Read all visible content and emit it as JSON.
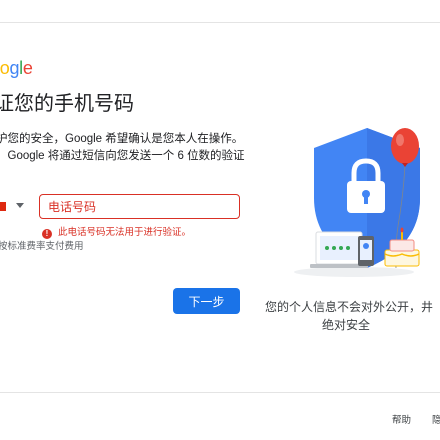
{
  "logo": {
    "text": "oogle",
    "colors": [
      "#4285f4",
      "#ea4335",
      "#fbbc05",
      "#4285f4",
      "#34a853",
      "#ea4335"
    ]
  },
  "page_title": "证您的手机号码",
  "description": {
    "line1": "护您的安全，Google 希望确认是您本人在操作。",
    "line2": "，Google 将通过短信向您发送一个 6 位数的验证"
  },
  "country_select": {
    "flag": "china-flag-icon",
    "selected": ""
  },
  "phone_field": {
    "placeholder": "电话号码",
    "value": ""
  },
  "error_message": "此电话号码无法用于进行验证。",
  "error_icon": "!",
  "fee_note": "按标准费率支付费用",
  "next_button": "下一步",
  "privacy": {
    "line1": "您的个人信息不会对外公开，井",
    "line2": "绝对安全"
  },
  "footer": {
    "help": "帮助",
    "more": "隐"
  },
  "colors": {
    "accent": "#1a73e8",
    "error": "#d93025",
    "shield": "#4285f4",
    "balloon": "#ea4335"
  }
}
